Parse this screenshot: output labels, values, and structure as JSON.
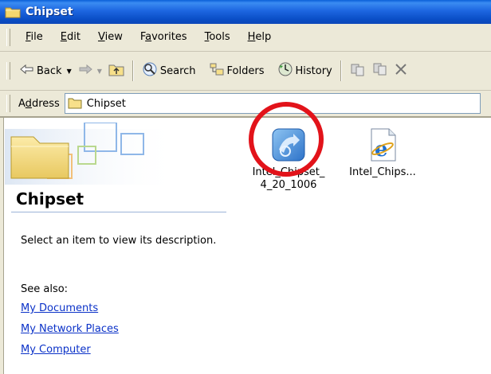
{
  "window": {
    "title": "Chipset"
  },
  "menubar": {
    "items": [
      {
        "label": "File",
        "accel_pre": "",
        "accel": "F",
        "accel_post": "ile"
      },
      {
        "label": "Edit",
        "accel_pre": "",
        "accel": "E",
        "accel_post": "dit"
      },
      {
        "label": "View",
        "accel_pre": "",
        "accel": "V",
        "accel_post": "iew"
      },
      {
        "label": "Favorites",
        "accel_pre": "F",
        "accel": "a",
        "accel_post": "vorites"
      },
      {
        "label": "Tools",
        "accel_pre": "",
        "accel": "T",
        "accel_post": "ools"
      },
      {
        "label": "Help",
        "accel_pre": "",
        "accel": "H",
        "accel_post": "elp"
      }
    ]
  },
  "toolbar": {
    "back_label": "Back",
    "search_label": "Search",
    "folders_label": "Folders",
    "history_label": "History"
  },
  "addressbar": {
    "label_pre": "A",
    "label_accel": "d",
    "label_post": "dress",
    "value": "Chipset"
  },
  "left_pane": {
    "title": "Chipset",
    "description": "Select an item to view its description.",
    "see_also": "See also:",
    "links": [
      "My Documents",
      "My Network Places",
      "My Computer"
    ]
  },
  "files": [
    {
      "name_line1": "Intel_Chipset_",
      "name_line2": "4_20_1006",
      "icon": "installer-icon"
    },
    {
      "name_line1": "Intel_Chips...",
      "name_line2": "",
      "icon": "ie-document-icon"
    }
  ],
  "colors": {
    "titlebar": "#0A4EC6",
    "highlight_circle": "#E2131A",
    "link": "#0B32C8"
  }
}
